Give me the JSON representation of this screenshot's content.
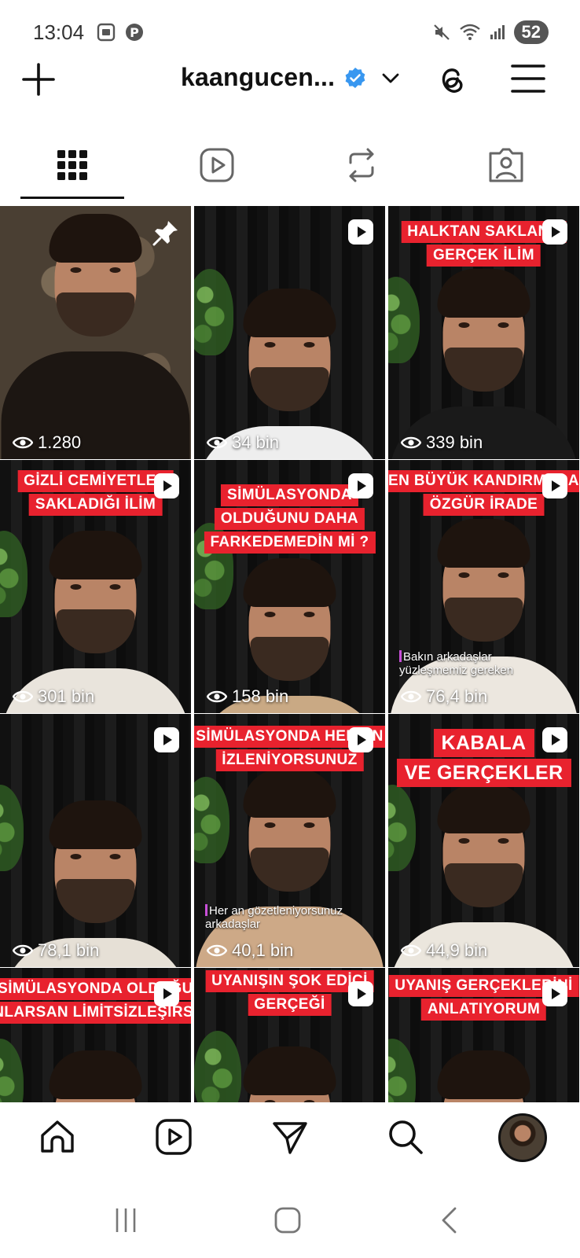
{
  "status_bar": {
    "time": "13:04",
    "battery": "52",
    "icons": [
      "screenshot-icon",
      "pinterest-icon",
      "mute-icon",
      "wifi-icon",
      "signal-icon"
    ]
  },
  "header": {
    "username": "kaangucen...",
    "verified": true,
    "icons": [
      "plus-icon",
      "verified-badge-icon",
      "chevron-down-icon",
      "threads-icon",
      "menu-icon"
    ]
  },
  "tabs": [
    {
      "name": "grid",
      "icon": "grid-icon",
      "active": true
    },
    {
      "name": "reels",
      "icon": "reels-icon",
      "active": false
    },
    {
      "name": "reposts",
      "icon": "repost-icon",
      "active": false
    },
    {
      "name": "tagged",
      "icon": "tagged-icon",
      "active": false
    }
  ],
  "posts": [
    {
      "views": "1.280",
      "type": "pinned",
      "caption": [],
      "subcaption": []
    },
    {
      "views": "34 bin",
      "type": "reel",
      "caption": [],
      "subcaption": []
    },
    {
      "views": "339 bin",
      "type": "reel",
      "caption": [
        "HALKTAN SAKLANA",
        "GERÇEK İLİM"
      ],
      "subcaption": []
    },
    {
      "views": "301 bin",
      "type": "reel",
      "caption": [
        "GİZLİ CEMİYETLER",
        "SAKLADIĞI İLİM"
      ],
      "subcaption": []
    },
    {
      "views": "158 bin",
      "type": "reel",
      "caption": [
        "SİMÜLASYONDA",
        "OLDUĞUNU DAHA",
        "FARKEDEMEDİN Mİ ?"
      ],
      "subcaption": []
    },
    {
      "views": "76,4 bin",
      "type": "reel",
      "caption": [
        "EN BÜYÜK KANDIRMACA",
        "ÖZGÜR İRADE"
      ],
      "subcaption": [
        "Bakın arkadaşlar",
        "yüzleşmemiz gereken"
      ]
    },
    {
      "views": "78,1 bin",
      "type": "reel",
      "caption": [],
      "subcaption": []
    },
    {
      "views": "40,1 bin",
      "type": "reel",
      "caption": [
        "SİMÜLASYONDA HER AN",
        "İZLENİYORSUNUZ"
      ],
      "subcaption": [
        "Her an gözetleniyorsunuz",
        "arkadaşlar"
      ]
    },
    {
      "views": "44,9 bin",
      "type": "reel",
      "caption": [
        "KABALA",
        "VE GERÇEKLER"
      ],
      "subcaption": []
    },
    {
      "views": "",
      "type": "reel",
      "caption": [
        "SİMÜLASYONDA OLDUĞU",
        "ANLARSAN LİMİTSİZLEŞİRSİN"
      ],
      "subcaption": []
    },
    {
      "views": "",
      "type": "reel",
      "caption": [
        "UYANIŞIN ŞOK EDİCİ",
        "GERÇEĞİ"
      ],
      "subcaption": []
    },
    {
      "views": "",
      "type": "reel",
      "caption": [
        "UYANIŞ GERÇEKLERİNİ",
        "ANLATIYORUM"
      ],
      "subcaption": []
    }
  ],
  "bottom_nav": [
    "home-icon",
    "reels-icon",
    "direct-message-icon",
    "search-icon",
    "profile-avatar"
  ],
  "system_nav": [
    "recent-apps-icon",
    "home-button-icon",
    "back-icon"
  ],
  "colors": {
    "caption_red": "#e8222e",
    "verified_blue": "#3897f0"
  }
}
